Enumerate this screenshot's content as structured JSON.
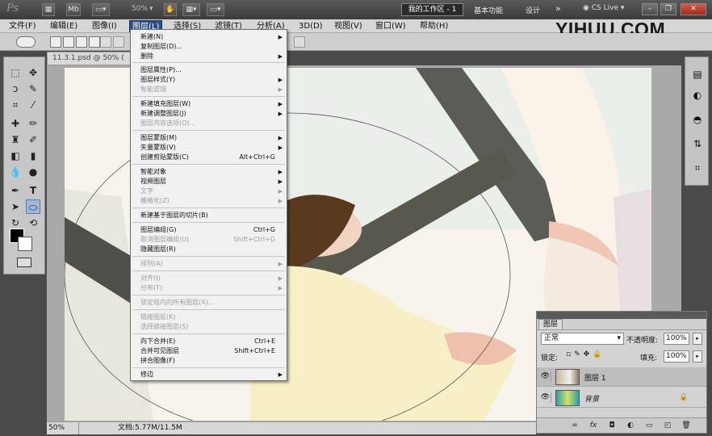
{
  "titlebar": {
    "app_logo": "Ps",
    "zoom_value": "50%",
    "workspace_current": "我的工作区 - 1",
    "workspace_links": [
      "基本功能",
      "设计"
    ],
    "overflow_arrows": "»",
    "cs_live": "CS Live"
  },
  "watermark": "YIHUU.COM",
  "menubar": {
    "items": [
      "文件(F)",
      "编辑(E)",
      "图像(I)",
      "图层(L)",
      "选择(S)",
      "滤镜(T)",
      "分析(A)",
      "3D(D)",
      "视图(V)",
      "窗口(W)",
      "帮助(H)"
    ]
  },
  "document": {
    "tab_label": "11.3.1.psd @ 50% (",
    "zoom": "50%",
    "doc_info": "文档:5.77M/11.5M"
  },
  "layer_menu": {
    "items": [
      {
        "label": "新建(N)",
        "arrow": true
      },
      {
        "label": "复制图层(D)...",
        "arrow": false
      },
      {
        "label": "删除",
        "arrow": true
      },
      {
        "label": "图层属性(P)...",
        "arrow": false
      },
      {
        "label": "图层样式(Y)",
        "arrow": true
      },
      {
        "label": "智能滤镜",
        "arrow": true,
        "disabled": true
      },
      {
        "label": "新建填充图层(W)",
        "arrow": true
      },
      {
        "label": "新建调整图层(J)",
        "arrow": true
      },
      {
        "label": "图层内容选项(O)...",
        "disabled": true
      },
      {
        "label": "图层蒙版(M)",
        "arrow": true
      },
      {
        "label": "矢量蒙版(V)",
        "arrow": true
      },
      {
        "label": "创建剪贴蒙版(C)",
        "shortcut": "Alt+Ctrl+G"
      },
      {
        "label": "智能对象",
        "arrow": true
      },
      {
        "label": "视频图层",
        "arrow": true
      },
      {
        "label": "文字",
        "arrow": true,
        "disabled": true
      },
      {
        "label": "栅格化(Z)",
        "arrow": true,
        "disabled": true
      },
      {
        "label": "新建基于图层的切片(B)"
      },
      {
        "label": "图层编组(G)",
        "shortcut": "Ctrl+G"
      },
      {
        "label": "取消图层编组(U)",
        "shortcut": "Shift+Ctrl+G",
        "disabled": true
      },
      {
        "label": "隐藏图层(R)"
      },
      {
        "label": "排列(A)",
        "arrow": true,
        "disabled": true
      },
      {
        "label": "对齐(I)",
        "arrow": true,
        "disabled": true
      },
      {
        "label": "分布(T)",
        "arrow": true,
        "disabled": true
      },
      {
        "label": "锁定组内的所有图层(X)...",
        "disabled": true
      },
      {
        "label": "链接图层(K)",
        "disabled": true
      },
      {
        "label": "选择链接图层(S)",
        "disabled": true
      },
      {
        "label": "向下合并(E)",
        "shortcut": "Ctrl+E"
      },
      {
        "label": "合并可见图层",
        "shortcut": "Shift+Ctrl+E"
      },
      {
        "label": "拼合图像(F)"
      },
      {
        "label": "修边",
        "arrow": true
      }
    ]
  },
  "layers_panel": {
    "tab": "图层",
    "blend_mode": "正常",
    "opacity_label": "不透明度:",
    "opacity_value": "100%",
    "lock_label": "锁定:",
    "fill_label": "填充:",
    "fill_value": "100%",
    "layers": [
      {
        "name": "图层 1",
        "selected": true
      },
      {
        "name": "背景",
        "selected": false,
        "locked": true
      }
    ],
    "footer_icons": [
      "link-icon",
      "fx-icon",
      "mask-icon",
      "adjustment-icon",
      "folder-icon",
      "new-layer-icon",
      "trash-icon"
    ]
  },
  "colors": {
    "menu_highlight": "#2b4f86",
    "foreground": "#000000",
    "background": "#ffffff"
  }
}
